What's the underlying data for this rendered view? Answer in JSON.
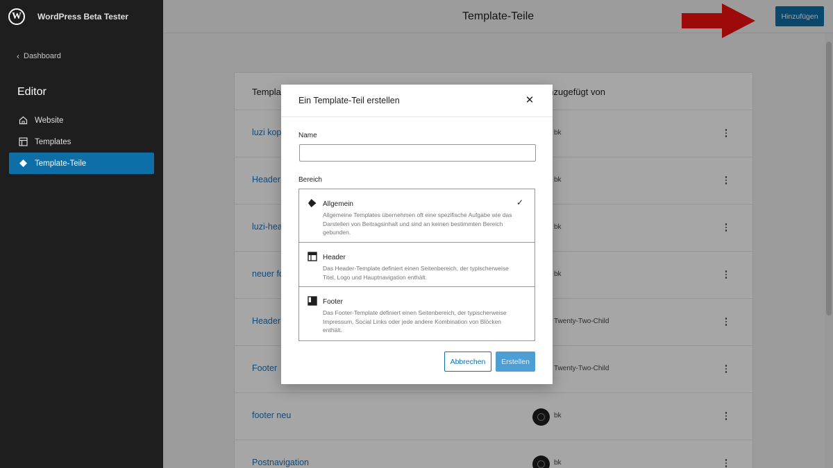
{
  "sidebar": {
    "site_title": "WordPress Beta Tester",
    "back_label": "Dashboard",
    "heading": "Editor",
    "items": [
      {
        "label": "Website"
      },
      {
        "label": "Templates"
      },
      {
        "label": "Template-Teile"
      }
    ]
  },
  "header": {
    "title": "Template-Teile",
    "add_label": "Hinzufügen"
  },
  "table": {
    "columns": [
      "Template",
      "Hinzugefügt von"
    ],
    "rows": [
      {
        "name": "luzi kop",
        "author": "bk"
      },
      {
        "name": "Header",
        "author": "bk"
      },
      {
        "name": "luzi-hea",
        "author": "bk"
      },
      {
        "name": "neuer fo",
        "author": "bk"
      },
      {
        "name": "Header",
        "author": "Twenty-Two-Child"
      },
      {
        "name": "Footer",
        "author": "Twenty-Two-Child"
      },
      {
        "name": "footer neu",
        "author": "bk"
      },
      {
        "name": "Postnavigation",
        "author": "bk"
      }
    ]
  },
  "modal": {
    "title": "Ein Template-Teil erstellen",
    "name_label": "Name",
    "name_value": "",
    "area_label": "Bereich",
    "options": [
      {
        "title": "Allgemein",
        "desc": "Allgemeine Templates übernehmen oft eine spezifische Aufgabe wie das Darstellen von Beitragsinhalt und sind an keinen bestimmten Bereich gebunden.",
        "selected": true
      },
      {
        "title": "Header",
        "desc": "Das Header-Template definiert einen Seitenbereich, der typischerweise Titel, Logo und Hauptnavigation enthält.",
        "selected": false
      },
      {
        "title": "Footer",
        "desc": "Das Footer-Template definiert einen Seitenbereich, der typischerweise Impressum, Social Links oder jede andere Kombination von Blöcken enthält.",
        "selected": false
      }
    ],
    "cancel_label": "Abbrechen",
    "create_label": "Erstellen"
  },
  "colors": {
    "accent": "#0e6ea8",
    "arrow": "#f01010"
  }
}
